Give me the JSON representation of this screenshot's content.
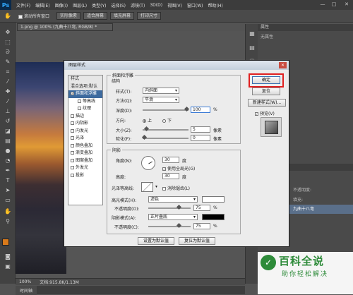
{
  "menubar": {
    "logo": "Ps",
    "items": [
      "文件(F)",
      "编辑(E)",
      "图像(I)",
      "图层(L)",
      "类型(Y)",
      "选择(S)",
      "滤镜(T)",
      "3D(D)",
      "视图(V)",
      "窗口(W)",
      "帮助(H)"
    ],
    "controls": [
      "—",
      "□",
      "✕"
    ]
  },
  "options": {
    "scroll_all": "滚动所有窗口",
    "actual_pixels": "实际像素",
    "fit_screen": "适合屏幕",
    "fill_screen": "填充屏幕",
    "print_size": "打印尺寸"
  },
  "document": {
    "tab": "1.png @ 100% (九曲十八弯, RGB/8) *",
    "zoom": "100%",
    "doc_size": "文档:915.8K/1.13M",
    "bottom_tab": "时间轴"
  },
  "right_panel": {
    "properties_tab": "属性",
    "no_properties": "无属性",
    "history_tab": "历史记录",
    "opacity_label": "不透明度:",
    "fill_label": "填充:",
    "layer_name": "九曲十八弯"
  },
  "dialog": {
    "title": "图层样式",
    "styles_header": "样式",
    "blend_options": "混合选项:默认",
    "style_items": [
      {
        "label": "斜面和浮雕",
        "checked": true,
        "selected": true,
        "sub": false
      },
      {
        "label": "等高线",
        "checked": false,
        "selected": false,
        "sub": true
      },
      {
        "label": "纹理",
        "checked": false,
        "selected": false,
        "sub": true
      },
      {
        "label": "描边",
        "checked": false,
        "selected": false,
        "sub": false
      },
      {
        "label": "内阴影",
        "checked": false,
        "selected": false,
        "sub": false
      },
      {
        "label": "内发光",
        "checked": false,
        "selected": false,
        "sub": false
      },
      {
        "label": "光泽",
        "checked": false,
        "selected": false,
        "sub": false
      },
      {
        "label": "颜色叠加",
        "checked": false,
        "selected": false,
        "sub": false
      },
      {
        "label": "渐变叠加",
        "checked": false,
        "selected": false,
        "sub": false
      },
      {
        "label": "图案叠加",
        "checked": false,
        "selected": false,
        "sub": false
      },
      {
        "label": "外发光",
        "checked": false,
        "selected": false,
        "sub": false
      },
      {
        "label": "投影",
        "checked": false,
        "selected": false,
        "sub": false
      }
    ],
    "bevel": {
      "section": "斜面和浮雕",
      "structure": "结构",
      "style_label": "样式(T):",
      "style_value": "内斜面",
      "technique_label": "方法(Q):",
      "technique_value": "平滑",
      "depth_label": "深度(D):",
      "depth_value": "100",
      "depth_unit": "%",
      "direction_label": "方向:",
      "dir_up": "上",
      "dir_down": "下",
      "size_label": "大小(Z):",
      "size_value": "5",
      "size_unit": "像素",
      "soften_label": "软化(F):",
      "soften_value": "0",
      "soften_unit": "像素",
      "depth_level": 1.0,
      "size_level": 0.05,
      "soften_level": 0.0
    },
    "shading": {
      "section": "阴影",
      "angle_label": "角度(N):",
      "angle_value": "30",
      "angle_unit": "度",
      "global_light": "使用全局光(G)",
      "altitude_label": "高度:",
      "altitude_value": "30",
      "altitude_unit": "度",
      "gloss_label": "光泽等高线:",
      "anti_alias": "消除锯齿(L)",
      "highlight_mode_label": "高光模式(H):",
      "highlight_mode_value": "滤色",
      "highlight_opacity_label": "不透明度(O):",
      "highlight_opacity_value": "75",
      "shadow_mode_label": "阴影模式(A):",
      "shadow_mode_value": "正片叠底",
      "shadow_opacity_label": "不透明度(C):",
      "shadow_opacity_value": "75",
      "percent": "%",
      "highlight_level": 0.75,
      "shadow_level": 0.75,
      "highlight_color": "#ffffff",
      "shadow_color": "#000000"
    },
    "make_default": "设置为默认值",
    "reset_default": "复位为默认值",
    "ok": "确定",
    "reset": "复位",
    "new_style": "新建样式(W)...",
    "preview": "预览(V)"
  },
  "watermark": {
    "title": "百科全说",
    "subtitle": "助你轻松解决"
  },
  "colors": {
    "highlight_red": "#e02020",
    "selection_blue": "#3d6a9e",
    "watermark_green": "#2e8b3a",
    "foreground_orange": "#d97a1b"
  }
}
